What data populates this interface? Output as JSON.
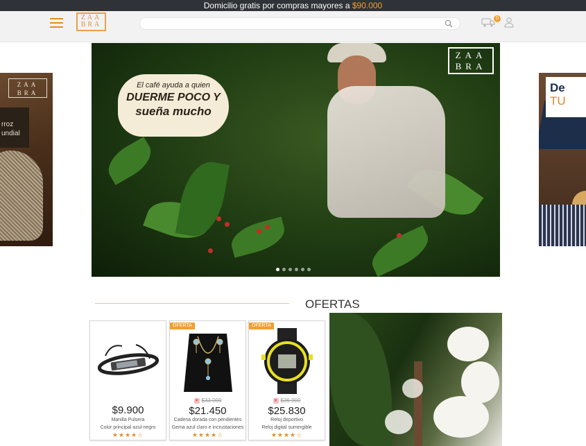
{
  "topbar": {
    "text": "Domicilio gratis por compras mayores a",
    "amount": "$90.000",
    "amount_color": "#f0a030"
  },
  "header": {
    "logo_top": "ZAA",
    "logo_bottom": "BRA",
    "search_placeholder": "",
    "cart_count": "0",
    "icons": [
      "menu-icon",
      "search-icon",
      "cart-icon",
      "user-icon"
    ]
  },
  "carousel": {
    "left_slide": {
      "logo_top": "ZAA",
      "logo_bottom": "BRA",
      "line1": "rroz",
      "line2": "undial"
    },
    "hero": {
      "logo_top": "ZAA",
      "logo_bottom": "BRA",
      "quote_line1": "El café ayuda a quien",
      "quote_line2": "DUERME POCO Y",
      "quote_line3": "sueña mucho",
      "dots_count": 6,
      "active_dot": 0
    },
    "right_slide": {
      "line1": "De",
      "line2": "TU"
    }
  },
  "ofertas": {
    "title": "OFERTAS",
    "products": [
      {
        "tag": "",
        "old_price": "",
        "price": "$9.900",
        "name": "Manilla Pulsera",
        "desc": "Color principal azul-negro",
        "stars": "★★★★☆"
      },
      {
        "tag": "OFERTA",
        "old_price": "$33.000",
        "price": "$21.450",
        "name": "Cadena dorada con pendientes",
        "desc": "Gema azul claro e incrustaciones",
        "stars": "★★★★☆"
      },
      {
        "tag": "OFERTA",
        "old_price": "$36.900",
        "price": "$25.830",
        "name": "Reloj deportivo",
        "desc": "Reloj digital sumergible",
        "stars": "★★★★☆"
      }
    ]
  },
  "colors": {
    "accent": "#f0a030",
    "topbar_bg": "#2f3236",
    "header_bg": "#f2f2f2"
  }
}
